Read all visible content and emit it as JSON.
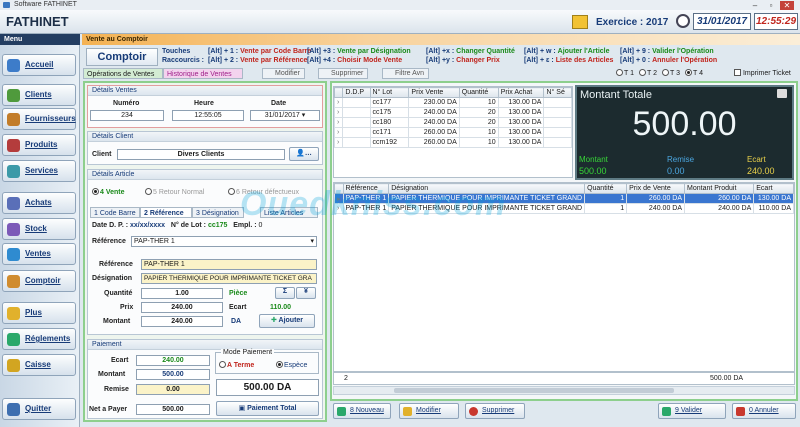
{
  "window": {
    "title": "Software FATHINET",
    "app_name": "FATHINET"
  },
  "header": {
    "exercice": "Exercice : 2017",
    "date": "31/01/2017",
    "time": "12:55:29"
  },
  "menu": {
    "title": "Menu",
    "items": [
      {
        "label": "Accueil",
        "icon": "home-icon",
        "color": "#3d7cc9"
      },
      {
        "label": "Clients",
        "icon": "clients-icon",
        "color": "#4f9a3c"
      },
      {
        "label": "Fournisseurs",
        "icon": "suppliers-icon",
        "color": "#c27d2a"
      },
      {
        "label": "Produits",
        "icon": "products-icon",
        "color": "#b43c3c"
      },
      {
        "label": "Services",
        "icon": "services-icon",
        "color": "#3c9aa8"
      },
      {
        "label": "Achats",
        "icon": "purchases-icon",
        "color": "#5a6fb8"
      },
      {
        "label": "Stock",
        "icon": "stock-icon",
        "color": "#7c5ab8"
      },
      {
        "label": "Ventes",
        "icon": "sales-icon",
        "color": "#2f8bd0"
      },
      {
        "label": "Comptoir",
        "icon": "counter-icon",
        "color": "#d08c2f"
      },
      {
        "label": "Plus",
        "icon": "plus-icon",
        "color": "#e1b12c"
      },
      {
        "label": "Réglements",
        "icon": "payments-icon",
        "color": "#2aa86a"
      },
      {
        "label": "Caisse",
        "icon": "cashbox-icon",
        "color": "#d2a521"
      },
      {
        "label": "Quitter",
        "icon": "exit-icon",
        "color": "#3e6fb0"
      }
    ]
  },
  "section_title": "Vente au Comptoir",
  "comptoir_label": "Comptoir",
  "shortcuts": {
    "touches": "Touches",
    "raccourcis": "Raccourcis :",
    "col1": [
      {
        "key": "[Alt] + 1 :",
        "text": "Vente par Code Barre",
        "cls": "r"
      },
      {
        "key": "[Alt] + 2 :",
        "text": "Vente par Référence",
        "cls": "r"
      }
    ],
    "col2": [
      {
        "key": "[Alt] +3 :",
        "text": "Vente par Désignation",
        "cls": "g"
      },
      {
        "key": "[Alt] +4 :",
        "text": "Choisir Mode Vente",
        "cls": "r"
      }
    ],
    "col3": [
      {
        "key": "[Alt] +x :",
        "text": "Changer Quantité",
        "cls": "g"
      },
      {
        "key": "[Alt] +y :",
        "text": "Changer Prix",
        "cls": "r"
      }
    ],
    "col4": [
      {
        "key": "[Alt] + w :",
        "text": "Ajouter l'Article",
        "cls": "g"
      },
      {
        "key": "[Alt] + ɛ :",
        "text": "Liste des Articles",
        "cls": "r"
      }
    ],
    "col5": [
      {
        "key": "[Alt] + 9 :",
        "text": "Valider l'Opération",
        "cls": "g"
      },
      {
        "key": "[Alt] + 0 :",
        "text": "Annuler l'Opération",
        "cls": "r"
      }
    ]
  },
  "tabs": {
    "operations": "Opérations de Ventes",
    "historique": "Historique de Ventes"
  },
  "toolbar": {
    "modifier": "Modifier",
    "supprimer": "Supprimer",
    "filtre": "Filtre Avn"
  },
  "ticket_options": [
    "T 1",
    "T 2",
    "T 3",
    "T 4"
  ],
  "ticket_selected": 3,
  "imprimer_ticket": "Imprimer Ticket",
  "details_ventes": {
    "title": "Détails Ventes",
    "numero_label": "Numéro",
    "numero": "234",
    "heure_label": "Heure",
    "heure": "12:55:05",
    "date_label": "Date",
    "date": "31/01/2017"
  },
  "details_client": {
    "title": "Détails Client",
    "client_label": "Client",
    "client": "Divers Clients"
  },
  "details_article": {
    "title": "Détails Article",
    "modes": [
      "4 Vente",
      "5 Retour Normal",
      "6 Retour défectueux"
    ],
    "subtabs": [
      "1 Code Barre",
      "2 Référence",
      "3 Désignation",
      "Liste Articles"
    ],
    "date_dp_label": "Date D. P. :",
    "date_dp": "xx/xx/xxxx",
    "lot_label": "N° de Lot :",
    "lot": "cc175",
    "emp_label": "Empl. :",
    "emp": "0",
    "ref_label": "Référence",
    "ref_select": "PAP-THER 1",
    "reference_label": "Référence",
    "reference": "PAP-THER 1",
    "designation_label": "Désignation",
    "designation": "PAPIER THERMIQUE POUR IMPRIMANTE TICKET GRA",
    "quantite_label": "Quantité",
    "quantite": "1.00",
    "unite": "Pièce",
    "prix_label": "Prix",
    "prix": "240.00",
    "ecart_label": "Ecart",
    "ecart": "110.00",
    "montant_label": "Montant",
    "montant": "240.00",
    "devise": "DA",
    "ajouter": "Ajouter"
  },
  "paiement": {
    "title": "Paiement",
    "ecart_label": "Ecart",
    "ecart": "240.00",
    "montant_label": "Montant",
    "montant": "500.00",
    "remise_label": "Remise",
    "remise": "0.00",
    "net_label": "Net a Payer",
    "net": "500.00",
    "mode_title": "Mode Paiement",
    "mode_terme": "A Terme",
    "mode_espece": "Espèce",
    "total_display": "500.00 DA",
    "paiement_total": "Paiement Total"
  },
  "lots_table": {
    "headers": [
      "D.D.P",
      "N° Lot",
      "Prix Vente",
      "Quantité",
      "Prix Achat",
      "N° Sé"
    ],
    "rows": [
      [
        "",
        "cc177",
        "230.00 DA",
        "10",
        "130.00 DA",
        ""
      ],
      [
        "",
        "cc175",
        "240.00 DA",
        "20",
        "130.00 DA",
        ""
      ],
      [
        "",
        "cc180",
        "240.00 DA",
        "20",
        "130.00 DA",
        ""
      ],
      [
        "",
        "cc171",
        "260.00 DA",
        "10",
        "130.00 DA",
        ""
      ],
      [
        "",
        "ccm192",
        "260.00 DA",
        "10",
        "130.00 DA",
        ""
      ]
    ]
  },
  "montant_totale": {
    "title": "Montant Totale",
    "value": "500.00",
    "montant_label": "Montant",
    "montant": "500.00",
    "remise_label": "Remise",
    "remise": "0.00",
    "ecart_label": "Ecart",
    "ecart": "240.00"
  },
  "lines_table": {
    "headers": [
      "Référence",
      "Désignation",
      "Quantité",
      "Prix de Vente",
      "Montant Produit",
      "Ecart"
    ],
    "rows": [
      [
        "PAP-THER 1",
        "PAPIER THERMIQUE POUR IMPRIMANTE TICKET GRAND",
        "1",
        "260.00 DA",
        "260.00 DA",
        "130.00 DA"
      ],
      [
        "PAP-THER 1",
        "PAPIER THERMIQUE POUR IMPRIMANTE TICKET GRAND",
        "1",
        "240.00 DA",
        "240.00 DA",
        "110.00 DA"
      ]
    ],
    "footer_count": "2",
    "footer_total": "500.00 DA"
  },
  "actions": {
    "nouveau": "8 Nouveau",
    "modifier": "Modifier",
    "supprimer": "Supprimer",
    "valider": "9 Valider",
    "annuler": "0 Annuler"
  },
  "watermark": "Ouedkniss.com"
}
